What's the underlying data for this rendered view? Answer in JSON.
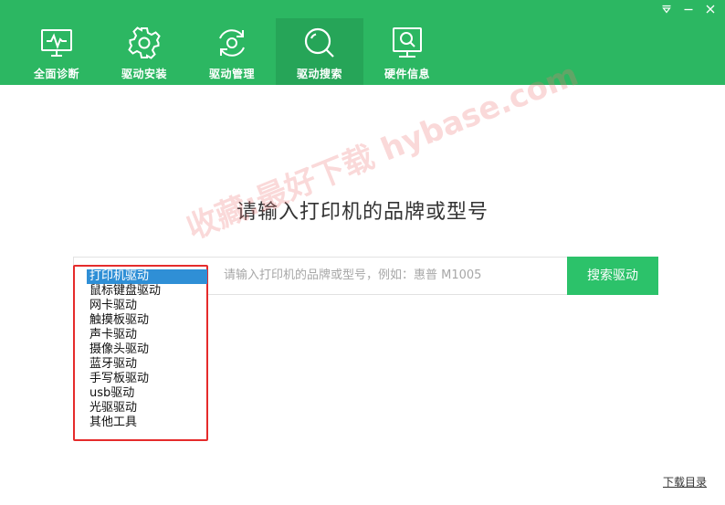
{
  "window": {
    "controls": [
      {
        "name": "menu-dropdown-icon"
      },
      {
        "name": "minimize-icon"
      },
      {
        "name": "close-icon"
      }
    ]
  },
  "nav": {
    "items": [
      {
        "label": "全面诊断",
        "icon": "monitor-pulse-icon",
        "active": false
      },
      {
        "label": "驱动安装",
        "icon": "gear-icon",
        "active": false
      },
      {
        "label": "驱动管理",
        "icon": "refresh-gear-icon",
        "active": false
      },
      {
        "label": "驱动搜索",
        "icon": "search-icon",
        "active": true
      },
      {
        "label": "硬件信息",
        "icon": "hardware-search-icon",
        "active": false
      }
    ]
  },
  "main": {
    "heading": "请输入打印机的品牌或型号",
    "search": {
      "placeholder": "请输入打印机的品牌或型号，例如：惠普 M1005",
      "button_label": "搜索驱动"
    },
    "categories": {
      "selected_index": 0,
      "items": [
        "打印机驱动",
        "鼠标键盘驱动",
        "网卡驱动",
        "触摸板驱动",
        "声卡驱动",
        "摄像头驱动",
        "蓝牙驱动",
        "手写板驱动",
        "usb驱动",
        "光驱驱动",
        "其他工具"
      ]
    },
    "watermark": "收藏:最好下载 hybase.com",
    "footer_link": "下载目录"
  },
  "colors": {
    "header_green": "#2cb762",
    "active_tab": "#26a558",
    "button_green": "#2cc26a",
    "selection_blue": "#2f8fd6",
    "highlight_red": "#e52b2b"
  }
}
